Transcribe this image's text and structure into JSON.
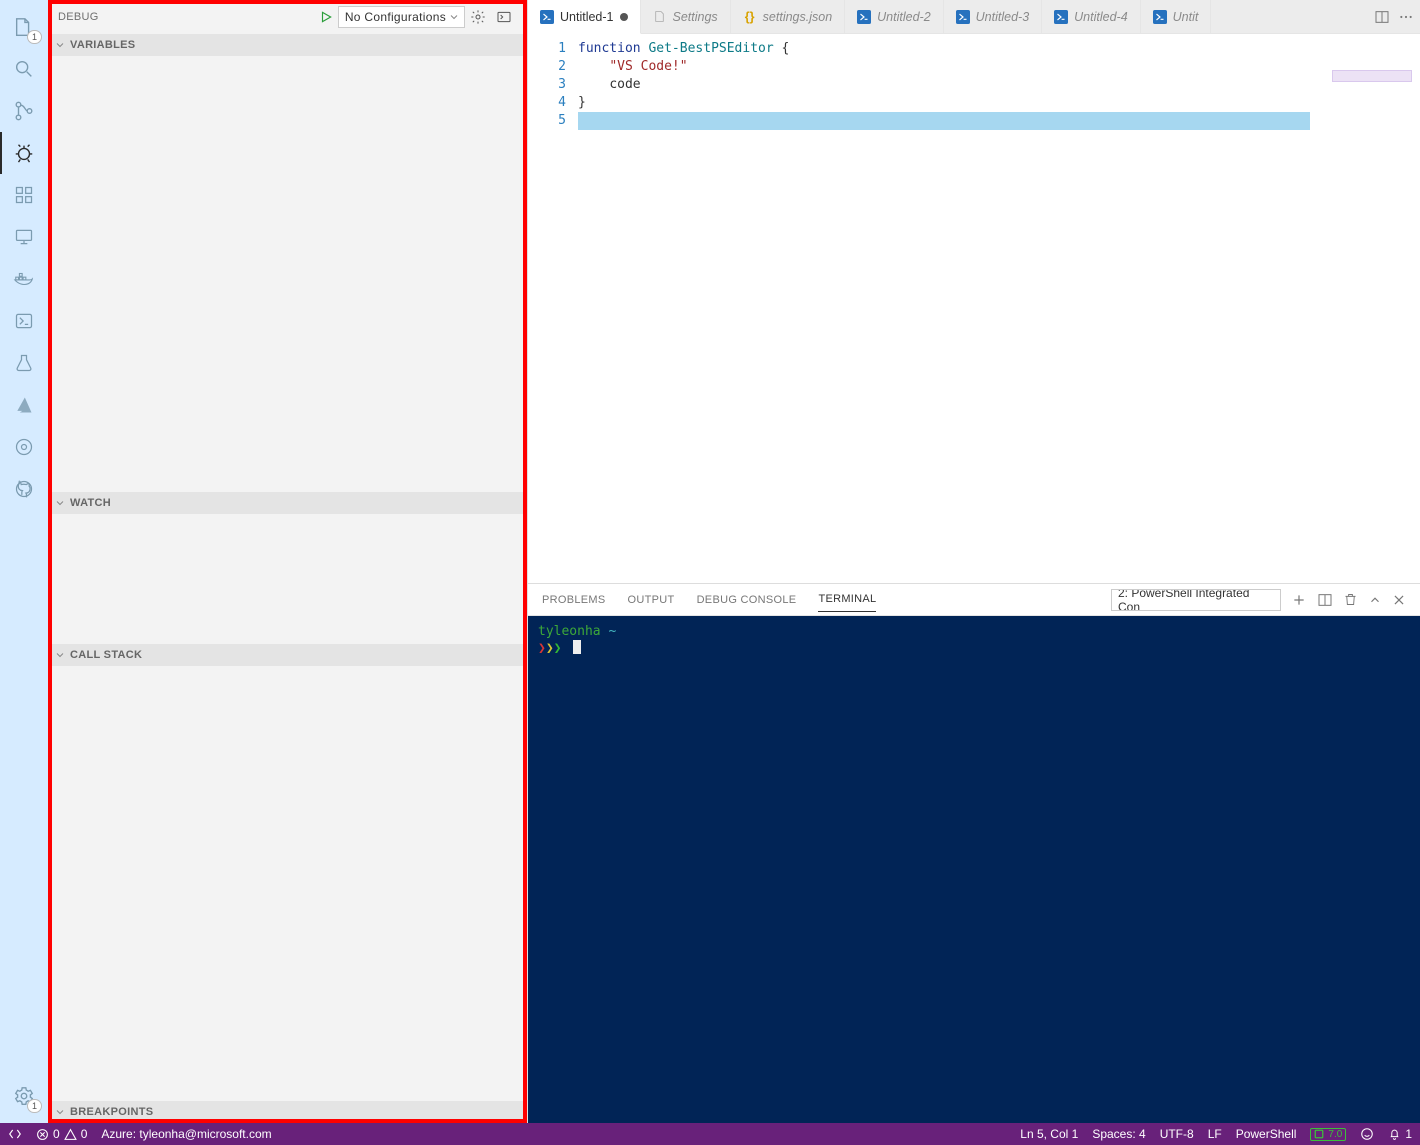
{
  "activity_bar": {
    "explorer_badge": "1",
    "settings_badge": "1"
  },
  "sidebar": {
    "title": "DEBUG",
    "config_selected": "No Configurations",
    "sections": {
      "variables": "VARIABLES",
      "watch": "WATCH",
      "callstack": "CALL STACK",
      "breakpoints": "BREAKPOINTS"
    }
  },
  "tabs": [
    {
      "label": "Untitled-1",
      "icon": "ps",
      "active": true,
      "dirty": true
    },
    {
      "label": "Settings",
      "icon": "none",
      "active": false,
      "dirty": false
    },
    {
      "label": "settings.json",
      "icon": "json",
      "active": false,
      "dirty": false
    },
    {
      "label": "Untitled-2",
      "icon": "ps",
      "active": false,
      "dirty": false
    },
    {
      "label": "Untitled-3",
      "icon": "ps",
      "active": false,
      "dirty": false
    },
    {
      "label": "Untitled-4",
      "icon": "ps",
      "active": false,
      "dirty": false
    },
    {
      "label": "Untit",
      "icon": "ps",
      "active": false,
      "dirty": false
    }
  ],
  "editor": {
    "line_numbers": [
      "1",
      "2",
      "3",
      "4",
      "5"
    ],
    "code": {
      "l1_kw": "function",
      "l1_fn": " Get-BestPSEditor ",
      "l1_br": "{",
      "l2_indent": "    ",
      "l2_str": "\"VS Code!\"",
      "l3_indent": "    ",
      "l3_txt": "code",
      "l4_br": "}"
    }
  },
  "panel": {
    "tabs": {
      "problems": "PROBLEMS",
      "output": "OUTPUT",
      "debug_console": "DEBUG CONSOLE",
      "terminal": "TERMINAL"
    },
    "terminal_selected": "2: PowerShell Integrated Con",
    "terminal_content": {
      "user": "tyleonha",
      "tilde": "~"
    }
  },
  "status": {
    "remote": "",
    "errors": "0",
    "warnings": "0",
    "azure": "Azure: tyleonha@microsoft.com",
    "cursor": "Ln 5, Col 1",
    "spaces": "Spaces: 4",
    "encoding": "UTF-8",
    "eol": "LF",
    "language": "PowerShell",
    "ps_ver": "7.0",
    "bell": "1"
  }
}
